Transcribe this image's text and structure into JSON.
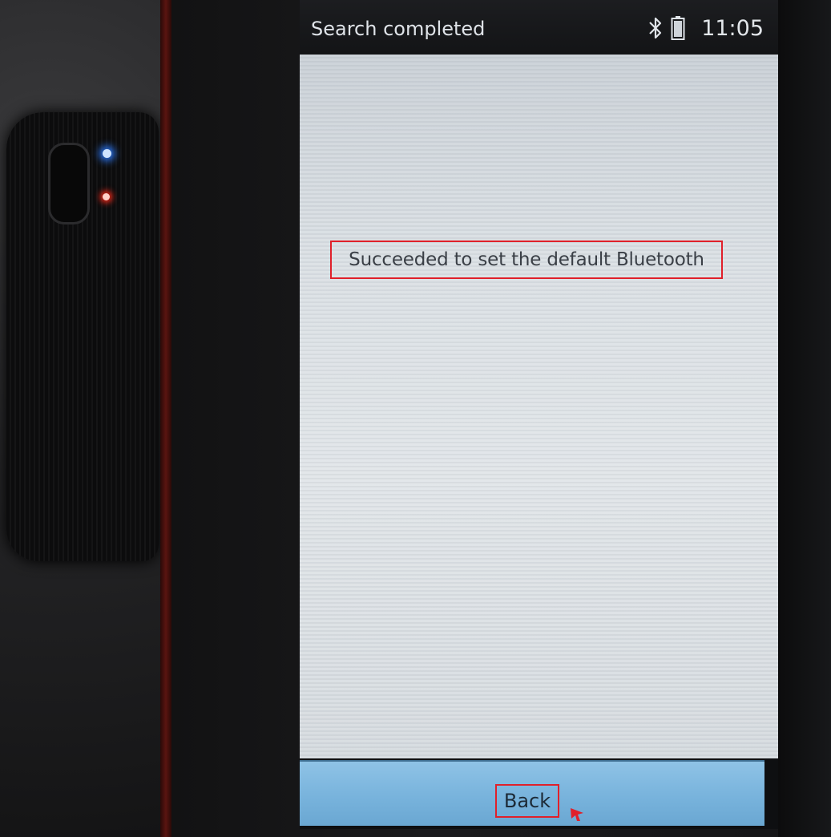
{
  "status_bar": {
    "title": "Search completed",
    "time": "11:05",
    "icons": [
      "bluetooth-icon",
      "battery-icon"
    ]
  },
  "dialog": {
    "message": "Succeeded to set the default Bluetooth"
  },
  "bottom_bar": {
    "back_label": "Back"
  },
  "colors": {
    "highlight_box": "#e0202a",
    "bottom_bar": "#78b3dc",
    "content_bg": "#dde2e6"
  }
}
